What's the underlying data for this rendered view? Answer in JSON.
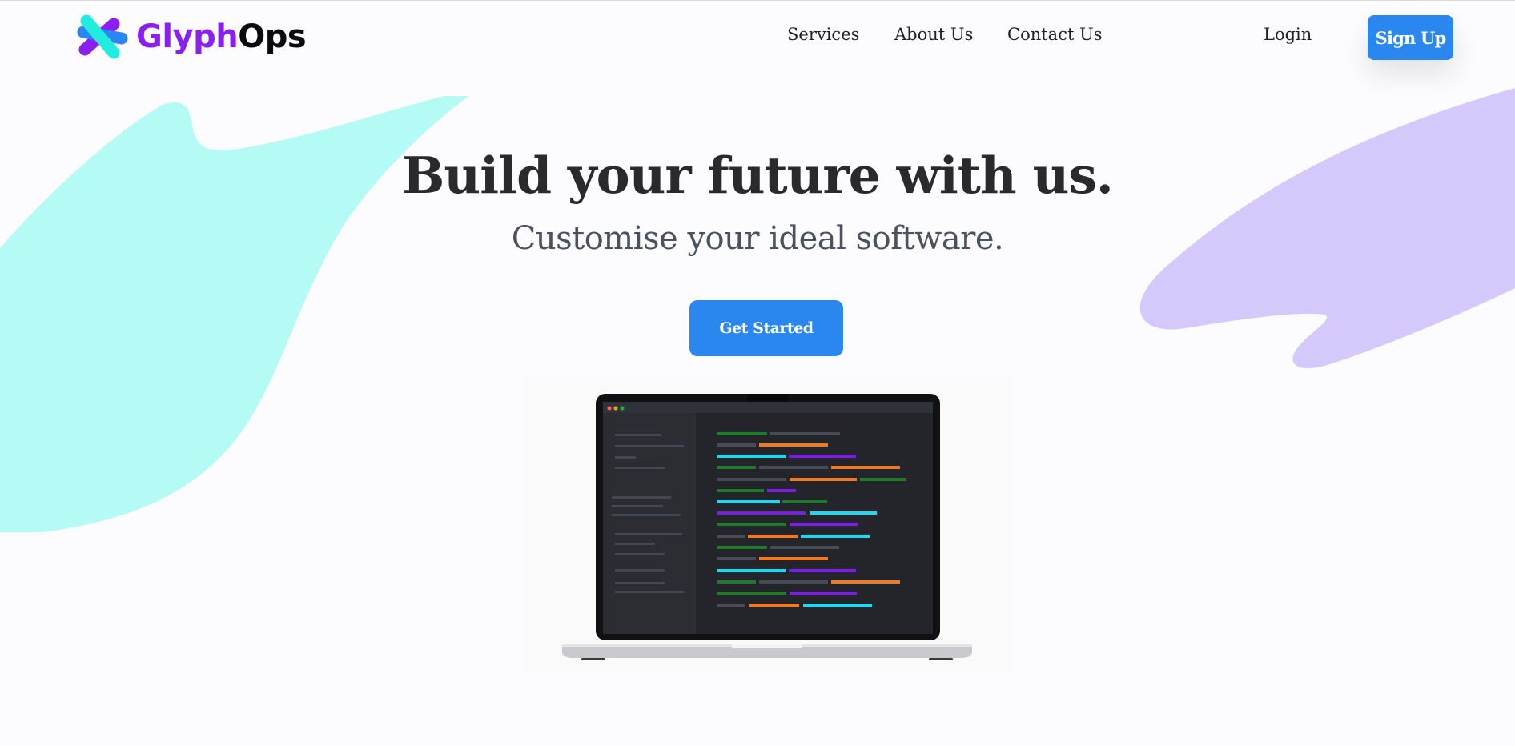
{
  "brand": {
    "name_part1": "Glyph",
    "name_part2": "Ops",
    "logo_icon": "x-cross-logo-icon"
  },
  "nav": {
    "links": [
      {
        "label": "Services"
      },
      {
        "label": "About Us"
      },
      {
        "label": "Contact Us"
      }
    ],
    "login_label": "Login",
    "signup_label": "Sign Up"
  },
  "hero": {
    "headline": "Build your future with us.",
    "subheadline": "Customise your ideal software.",
    "cta_label": "Get Started",
    "illustration": "laptop-code-illustration"
  },
  "colors": {
    "accent_blue": "#2a87f0",
    "brand_purple": "#8a1ff0",
    "blob_cyan": "#b3fbf4",
    "blob_lavender": "#d5c8fa"
  }
}
